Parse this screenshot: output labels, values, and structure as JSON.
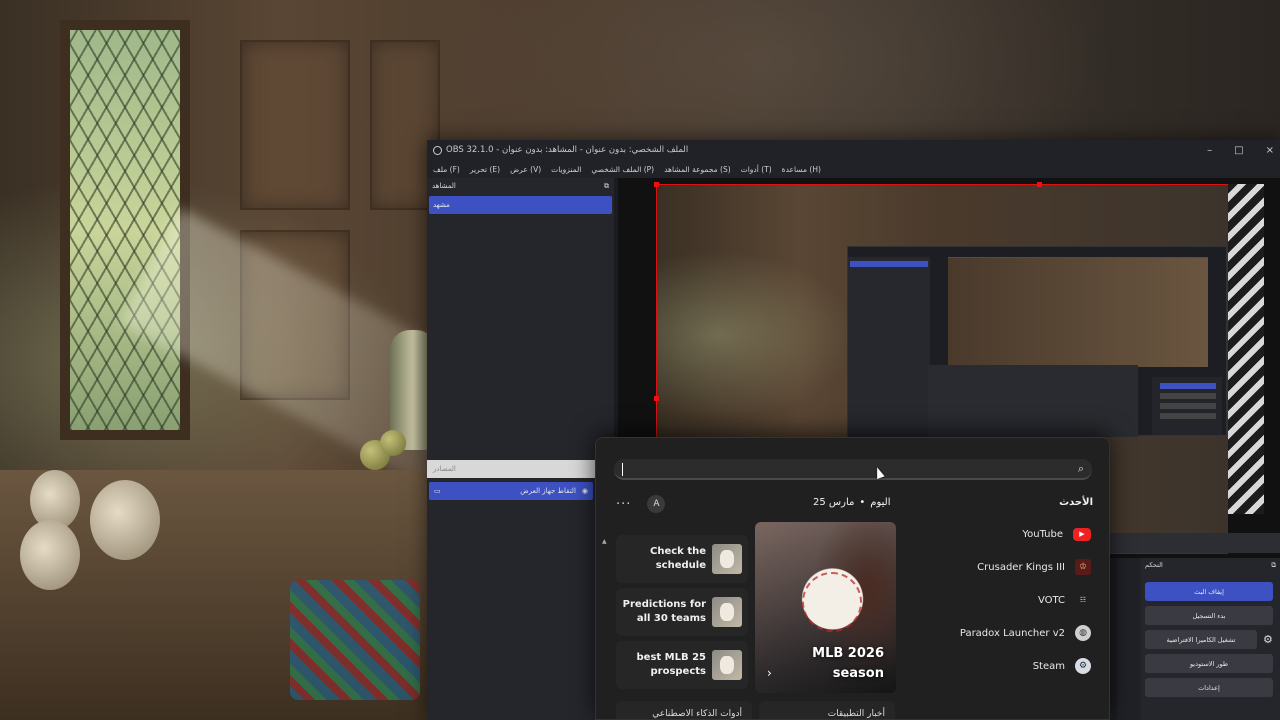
{
  "obs": {
    "title": "OBS 32.1.0 - الملف الشخصي: بدون عنوان - المشاهد: بدون عنوان",
    "window_controls": [
      "–",
      "□",
      "×"
    ],
    "menu": [
      "ملف (F)",
      "تحرير (E)",
      "عرض (V)",
      "المنزويات",
      "الملف الشخصي (P)",
      "مجموعة المشاهد (S)",
      "أدوات (T)",
      "مساعدة (H)"
    ],
    "scenes_title": "المشاهد",
    "scene_item": "مشهد",
    "sources_search_placeholder": "المصادر",
    "source_item": "التقاط جهاز العرض",
    "controls_title": "التحكم",
    "controls": [
      "إيقاف البث",
      "بدء التسجيل",
      "تشغيل الكاميرا الافتراضية",
      "طور الاستوديو",
      "إعدادات"
    ]
  },
  "start_menu": {
    "search_placeholder": "",
    "avatar_letter": "A",
    "today": "اليوم",
    "date": "25 مارس",
    "bullet": "•",
    "recent_title": "الأحدث",
    "news": [
      {
        "text": "Check the schedule"
      },
      {
        "text": "Predictions for all 30 teams"
      },
      {
        "text": "best MLB 25 prospects"
      }
    ],
    "feature": {
      "title": "MLB 2026 season",
      "next": "›"
    },
    "recent": [
      {
        "label": "YouTube",
        "icon": "youtube-icon"
      },
      {
        "label": "Crusader Kings III",
        "icon": "crusader-kings-icon"
      },
      {
        "label": "VOTC",
        "icon": "votc-icon"
      },
      {
        "label": "Paradox Launcher v2",
        "icon": "paradox-icon"
      },
      {
        "label": "Steam",
        "icon": "steam-icon"
      }
    ],
    "bottom_cards": [
      "أخبار التطبيقات",
      "أدوات الذكاء الاصطناعي"
    ]
  },
  "colors": {
    "accent": "#3d51c3",
    "panel": "#202020",
    "red_selection": "#dd1111"
  }
}
